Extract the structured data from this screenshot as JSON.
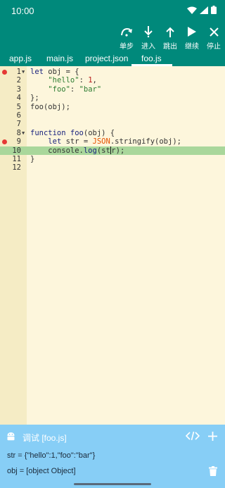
{
  "status_bar": {
    "time": "10:00"
  },
  "toolbar": {
    "step_label": "单步",
    "step_into_label": "进入",
    "step_out_label": "跳出",
    "continue_label": "继续",
    "stop_label": "停止"
  },
  "tabs": [
    {
      "label": "app.js"
    },
    {
      "label": "main.js"
    },
    {
      "label": "project.json"
    },
    {
      "label": "foo.js"
    }
  ],
  "editor": {
    "line_numbers": [
      "1",
      "2",
      "3",
      "4",
      "5",
      "6",
      "7",
      "8",
      "9",
      "10",
      "11",
      "12"
    ],
    "breakpoint_lines": [
      1,
      9
    ],
    "current_line": 10
  },
  "debug": {
    "title": "调试 [foo.js]",
    "variables": [
      "str = {\"hello\":1,\"foo\":\"bar\"}",
      "obj = [object Object]"
    ]
  }
}
